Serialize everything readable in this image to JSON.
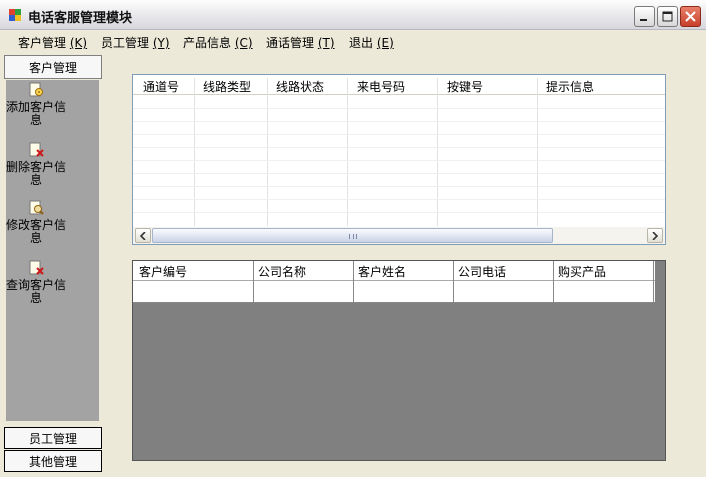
{
  "window": {
    "title": "电话客服管理模块"
  },
  "menu": [
    {
      "label": "客户管理",
      "key": "(K)"
    },
    {
      "label": "员工管理",
      "key": "(Y)"
    },
    {
      "label": "产品信息",
      "key": "(C)"
    },
    {
      "label": "通话管理",
      "key": "(T)"
    },
    {
      "label": "退出",
      "key": "(E)"
    }
  ],
  "sidebar": {
    "active_group": "客户管理",
    "entries": [
      {
        "label": "添加客户信息",
        "icon": "add-customer-icon"
      },
      {
        "label": "删除客户信息",
        "icon": "delete-customer-icon"
      },
      {
        "label": "修改客户信息",
        "icon": "edit-customer-icon"
      },
      {
        "label": "查询客户信息",
        "icon": "query-customer-icon"
      }
    ],
    "bottom_groups": [
      "员工管理",
      "其他管理"
    ]
  },
  "call_grid": {
    "columns": [
      "通道号",
      "线路类型",
      "线路状态",
      "来电号码",
      "按键号",
      "提示信息"
    ],
    "rows": []
  },
  "customer_grid": {
    "columns": [
      "客户编号",
      "公司名称",
      "客户姓名",
      "公司电话",
      "购买产品"
    ],
    "rows": [
      [
        "",
        "",
        "",
        "",
        ""
      ]
    ]
  },
  "colors": {
    "nav_panel": "#a3a3a3",
    "grid_empty": "#808080",
    "close_button": "#c8402a"
  }
}
